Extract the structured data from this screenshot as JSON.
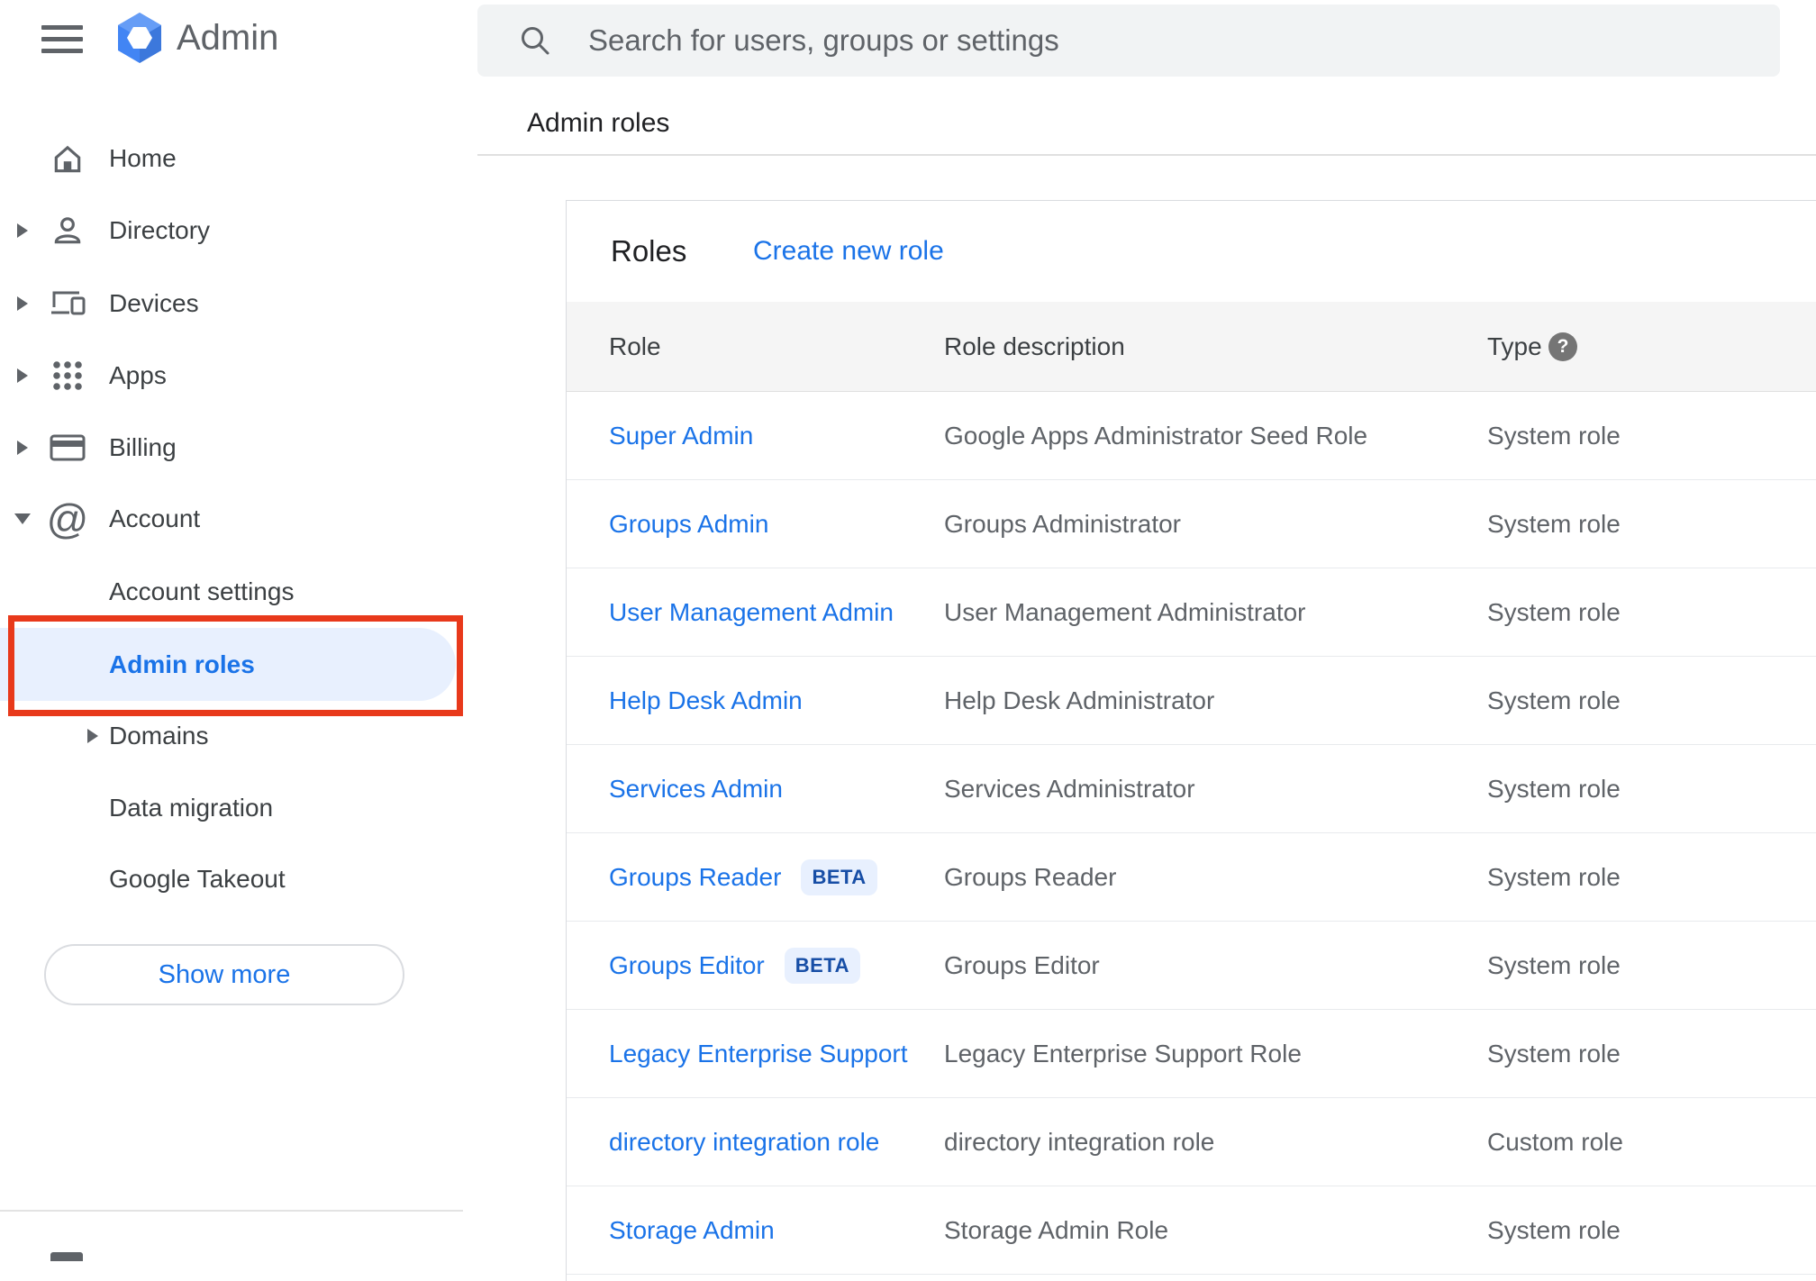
{
  "topbar": {
    "product_name": "Admin",
    "search_placeholder": "Search for users, groups or settings"
  },
  "sidebar": {
    "items": [
      {
        "label": "Home"
      },
      {
        "label": "Directory"
      },
      {
        "label": "Devices"
      },
      {
        "label": "Apps"
      },
      {
        "label": "Billing"
      },
      {
        "label": "Account"
      },
      {
        "label": "Account settings"
      },
      {
        "label": "Admin roles",
        "selected": true
      },
      {
        "label": "Domains"
      },
      {
        "label": "Data migration"
      },
      {
        "label": "Google Takeout"
      }
    ],
    "show_more_label": "Show more"
  },
  "main": {
    "breadcrumb": "Admin roles",
    "card": {
      "title": "Roles",
      "create_link_label": "Create new role",
      "columns": [
        "Role",
        "Role description",
        "Type"
      ],
      "rows": [
        {
          "name": "Super Admin",
          "description": "Google Apps Administrator Seed Role",
          "type": "System role"
        },
        {
          "name": "Groups Admin",
          "description": "Groups Administrator",
          "type": "System role"
        },
        {
          "name": "User Management Admin",
          "description": "User Management Administrator",
          "type": "System role"
        },
        {
          "name": "Help Desk Admin",
          "description": "Help Desk Administrator",
          "type": "System role"
        },
        {
          "name": "Services Admin",
          "description": "Services Administrator",
          "type": "System role"
        },
        {
          "name": "Groups Reader",
          "badge": "BETA",
          "description": "Groups Reader",
          "type": "System role"
        },
        {
          "name": "Groups Editor",
          "badge": "BETA",
          "description": "Groups Editor",
          "type": "System role"
        },
        {
          "name": "Legacy Enterprise Support",
          "description": "Legacy Enterprise Support Role",
          "type": "System role"
        },
        {
          "name": "directory integration role",
          "description": "directory integration role",
          "type": "Custom role"
        },
        {
          "name": "Storage Admin",
          "description": "Storage Admin Role",
          "type": "System role"
        }
      ]
    }
  },
  "icons": {
    "help_glyph": "?",
    "account_glyph": "@"
  },
  "colors": {
    "accent_blue": "#1a73e8",
    "selected_item_bg": "#e8f0fe",
    "annotation_red": "#e8391b",
    "badge_bg": "#e8f0fe",
    "badge_text": "#174ea6",
    "search_bg": "#f1f3f4",
    "table_header_bg": "#f5f5f5"
  }
}
